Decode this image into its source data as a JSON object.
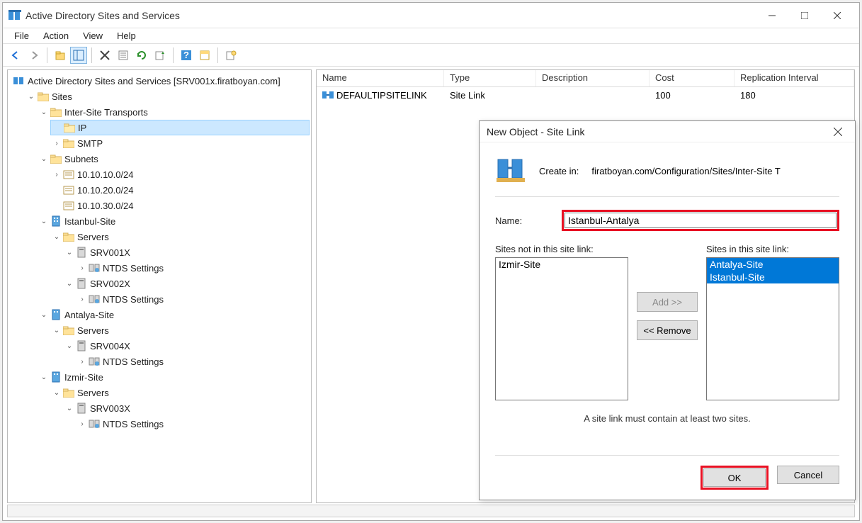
{
  "window": {
    "title": "Active Directory Sites and Services"
  },
  "menu": {
    "file": "File",
    "action": "Action",
    "view": "View",
    "help": "Help"
  },
  "tree": {
    "root": "Active Directory Sites and Services [SRV001x.firatboyan.com]",
    "sites": "Sites",
    "ist": "Inter-Site Transports",
    "ip": "IP",
    "smtp": "SMTP",
    "subnets": "Subnets",
    "sn1": "10.10.10.0/24",
    "sn2": "10.10.20.0/24",
    "sn3": "10.10.30.0/24",
    "site1": "Istanbul-Site",
    "site2": "Antalya-Site",
    "site3": "Izmir-Site",
    "servers": "Servers",
    "srv1": "SRV001X",
    "srv2": "SRV002X",
    "srv3": "SRV003X",
    "srv4": "SRV004X",
    "ntds": "NTDS Settings"
  },
  "list": {
    "cols": {
      "name": "Name",
      "type": "Type",
      "desc": "Description",
      "cost": "Cost",
      "repl": "Replication Interval"
    },
    "row": {
      "name": "DEFAULTIPSITELINK",
      "type": "Site Link",
      "desc": "",
      "cost": "100",
      "repl": "180"
    }
  },
  "dialog": {
    "title": "New Object - Site Link",
    "createin_label": "Create in:",
    "createin_path": "firatboyan.com/Configuration/Sites/Inter-Site T",
    "name_label": "Name:",
    "name_value": "Istanbul-Antalya",
    "notin_label": "Sites not in this site link:",
    "in_label": "Sites in this site link:",
    "notin_items": [
      "Izmir-Site"
    ],
    "in_items": [
      "Antalya-Site",
      "Istanbul-Site"
    ],
    "add": "Add >>",
    "remove": "<< Remove",
    "hint": "A site link must contain at least two sites.",
    "ok": "OK",
    "cancel": "Cancel"
  }
}
